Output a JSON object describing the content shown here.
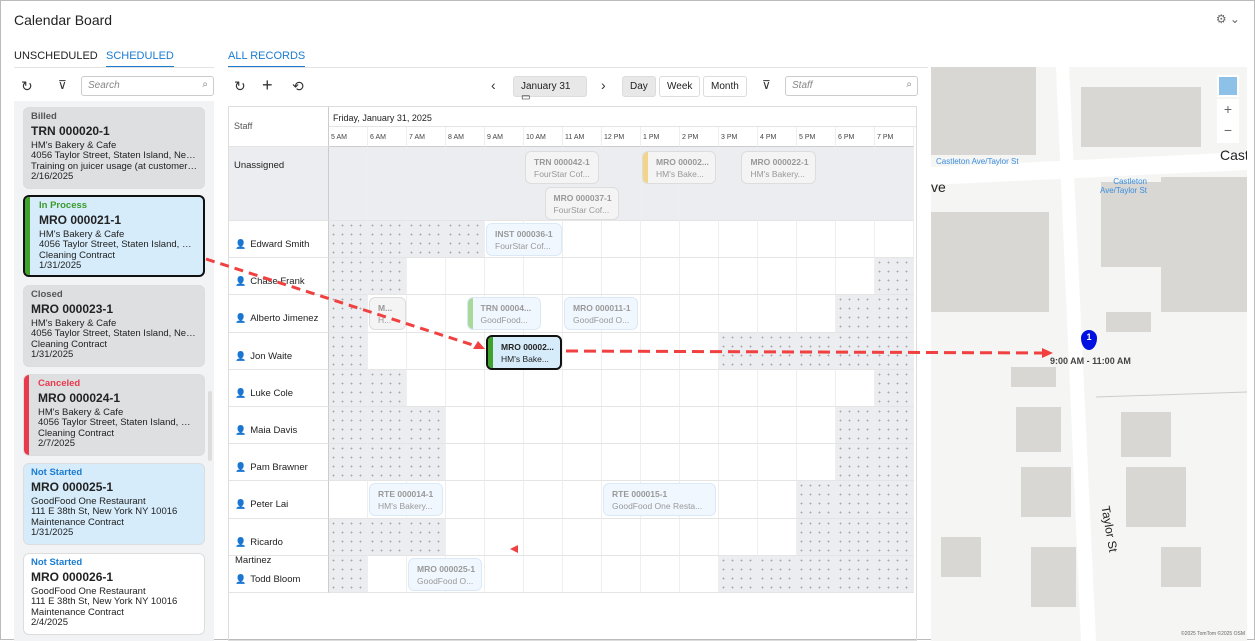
{
  "header": {
    "title": "Calendar Board",
    "settings_icon": "gear-icon"
  },
  "left_tabs": [
    {
      "label": "UNSCHEDULED",
      "active": false
    },
    {
      "label": "SCHEDULED",
      "active": true
    }
  ],
  "left_toolbar": {
    "search_placeholder": "Search"
  },
  "cards": [
    {
      "status": "Billed",
      "status_color": "#555",
      "number": "TRN 000020-1",
      "lines": [
        "HM's Bakery & Cafe",
        "4056 Taylor Street, Staten Island, New Y...",
        "Training on juicer usage (at customer's pl...",
        "2/16/2025"
      ],
      "bg": "#dedfe1",
      "bar": null
    },
    {
      "status": "In Process",
      "status_color": "#3a9a2a",
      "number": "MRO 000021-1",
      "lines": [
        "HM's Bakery & Cafe",
        "4056 Taylor Street, Staten Island, New ...",
        "Cleaning Contract",
        "1/31/2025"
      ],
      "bg": "#d6ecfb",
      "bar": "#3fa32b",
      "selected": true
    },
    {
      "status": "Closed",
      "status_color": "#555",
      "number": "MRO 000023-1",
      "lines": [
        "HM's Bakery & Cafe",
        "4056 Taylor Street, Staten Island, New Y...",
        "Cleaning Contract",
        "1/31/2025"
      ],
      "bg": "#dedfe1",
      "bar": null
    },
    {
      "status": "Canceled",
      "status_color": "#e8394d",
      "number": "MRO 000024-1",
      "lines": [
        "HM's Bakery & Cafe",
        "4056 Taylor Street, Staten Island, New ...",
        "Cleaning Contract",
        "2/7/2025"
      ],
      "bg": "#dedfe1",
      "bar": "#e8394d"
    },
    {
      "status": "Not Started",
      "status_color": "#1a7bd1",
      "number": "MRO 000025-1",
      "lines": [
        "GoodFood One Restaurant",
        "111 E 38th St, New York NY 10016",
        "Maintenance Contract",
        "1/31/2025"
      ],
      "bg": "#d6ecfb",
      "bar": null
    },
    {
      "status": "Not Started",
      "status_color": "#1a7bd1",
      "number": "MRO 000026-1",
      "lines": [
        "GoodFood One Restaurant",
        "111 E 38th St, New York NY 10016",
        "Maintenance Contract",
        "2/4/2025"
      ],
      "bg": "#ffffff",
      "bar": null
    }
  ],
  "main_tab": "ALL RECORDS",
  "toolbar": {
    "date": "January 31",
    "views": [
      "Day",
      "Week",
      "Month"
    ],
    "active_view": "Day",
    "staff_placeholder": "Staff"
  },
  "schedule": {
    "staff_header": "Staff",
    "date_label": "Friday, January 31, 2025",
    "hours": [
      "5 AM",
      "6 AM",
      "7 AM",
      "8 AM",
      "9 AM",
      "10 AM",
      "11 AM",
      "12 PM",
      "1 PM",
      "2 PM",
      "3 PM",
      "4 PM",
      "5 PM",
      "6 PM",
      "7 PM"
    ],
    "unassigned_label": "Unassigned",
    "unassigned_events": [
      {
        "id": "TRN 000042-1",
        "sub": "FourStar Cof...",
        "start": 5,
        "dur": 1.9,
        "lane": 0
      },
      {
        "id": "MRO 00002...",
        "sub": "HM's Bake...",
        "start": 8,
        "dur": 1.9,
        "lane": 0,
        "bar": "#f2d48a"
      },
      {
        "id": "MRO 000022-1",
        "sub": "HM's Bakery...",
        "start": 10.55,
        "dur": 1.9,
        "lane": 0
      },
      {
        "id": "MRO 000037-1",
        "sub": "FourStar Cof...",
        "start": 5.5,
        "dur": 1.9,
        "lane": 1
      }
    ],
    "staff": [
      {
        "name": "Edward Smith",
        "off": [
          [
            0,
            4
          ]
        ],
        "events": [
          {
            "id": "INST 000036-1",
            "sub": "FourStar Cof...",
            "start": 4,
            "dur": 1.95
          }
        ]
      },
      {
        "name": "Chase Frank",
        "off": [
          [
            0,
            2
          ],
          [
            14,
            15
          ]
        ],
        "events": []
      },
      {
        "name": "Alberto Jimenez",
        "off": [
          [
            0,
            1
          ],
          [
            13,
            15
          ]
        ],
        "events": [
          {
            "id": "M...",
            "sub": "H...",
            "start": 1,
            "dur": 0.95,
            "gray": true
          },
          {
            "id": "TRN 00004...",
            "sub": "GoodFood...",
            "start": 3.5,
            "dur": 1.9,
            "bar": "#a8d89a"
          },
          {
            "id": "MRO 000011-1",
            "sub": "GoodFood O...",
            "start": 6,
            "dur": 1.9
          }
        ]
      },
      {
        "name": "Jon Waite",
        "off": [
          [
            0,
            1
          ],
          [
            10,
            15
          ]
        ],
        "events": [
          {
            "id": "MRO 00002...",
            "sub": "HM's Bake...",
            "start": 4,
            "dur": 1.95,
            "bar": "#3fa32b",
            "selected": true
          }
        ]
      },
      {
        "name": "Luke Cole",
        "off": [
          [
            0,
            2
          ],
          [
            14,
            15
          ]
        ],
        "events": []
      },
      {
        "name": "Maia Davis",
        "off": [
          [
            0,
            3
          ],
          [
            13,
            15
          ]
        ],
        "events": []
      },
      {
        "name": "Pam Brawner",
        "off": [
          [
            0,
            3
          ],
          [
            13,
            15
          ]
        ],
        "events": []
      },
      {
        "name": "Peter Lai",
        "off": [
          [
            12,
            15
          ]
        ],
        "events": [
          {
            "id": "RTE 000014-1",
            "sub": "HM's Bakery...",
            "start": 1,
            "dur": 1.9
          },
          {
            "id": "RTE 000015-1",
            "sub": "GoodFood One Resta...",
            "start": 7,
            "dur": 2.9
          }
        ]
      },
      {
        "name": "Ricardo Martinez",
        "off": [
          [
            0,
            3
          ],
          [
            12,
            15
          ]
        ],
        "events": []
      },
      {
        "name": "Todd Bloom",
        "off": [
          [
            0,
            1
          ],
          [
            10,
            15
          ]
        ],
        "events": [
          {
            "id": "MRO 000025-1",
            "sub": "GoodFood O...",
            "start": 2,
            "dur": 1.9
          }
        ]
      }
    ]
  },
  "map": {
    "street_main": "Castleton",
    "street_left": "ve",
    "street_vertical": "Taylor St",
    "bus_stop_1": "Castleton Ave/Taylor St",
    "bus_stop_2": "Castleton Ave/Taylor St",
    "pin_number": "1",
    "pin_time": "9:00 AM - 11:00 AM",
    "copyright": "©2025 TomTom ©2025 OSM",
    "buildings": [
      "1231",
      "1229",
      "177",
      "1211",
      "1209",
      "1205",
      "1230",
      "200",
      "1214",
      "1210",
      "1204",
      "1206",
      "1200",
      "207",
      "208",
      "214",
      "216",
      "217",
      "219",
      "221",
      "223",
      "225",
      "227",
      "226",
      "228",
      "229",
      "230",
      "231",
      "232",
      "234",
      "236"
    ]
  }
}
